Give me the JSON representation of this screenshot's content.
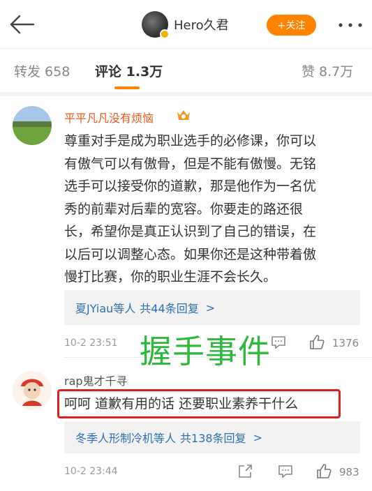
{
  "header": {
    "author_name": "Hero久君",
    "follow_label": "+关注"
  },
  "tabs": {
    "repost": "转发 658",
    "comments": "评论 1.3万",
    "likes": "赞 8.7万"
  },
  "comments": [
    {
      "user": "平平凡凡没有烦恼",
      "user_color": "#e8591a",
      "text_lines": [
        "尊重对手是成为职业选手的必修课，你可以",
        "有傲气可以有傲骨，但是不能有傲慢。无铭",
        "选手可以接受你的道歉，那是他作为一名优",
        "秀的前辈对后辈的宽容。你要走的路还很",
        "长，希望你是真正认识到了自己的错误，在",
        "以后可以调整心态。如果你还是这种带着傲",
        "慢打比赛，你的职业生涯不会长久。"
      ],
      "reply_prefix": "夏JYiau等人",
      "reply_count": "共44条回复",
      "reply_more": ">",
      "time": "10-2 23:51",
      "likes": "1376"
    },
    {
      "user": "rap鬼才千寻",
      "user_color": "#555555",
      "text": "呵呵 道歉有用的话 还要职业素养干什么",
      "reply_prefix": "冬季人形制冷机等人",
      "reply_count": "共138条回复",
      "reply_more": ">",
      "time": "10-2 23:44",
      "likes": "983"
    }
  ],
  "overlay": {
    "watermark": "握手事件",
    "watermark_color": "#2db93c",
    "highlight_color": "#e02020"
  }
}
